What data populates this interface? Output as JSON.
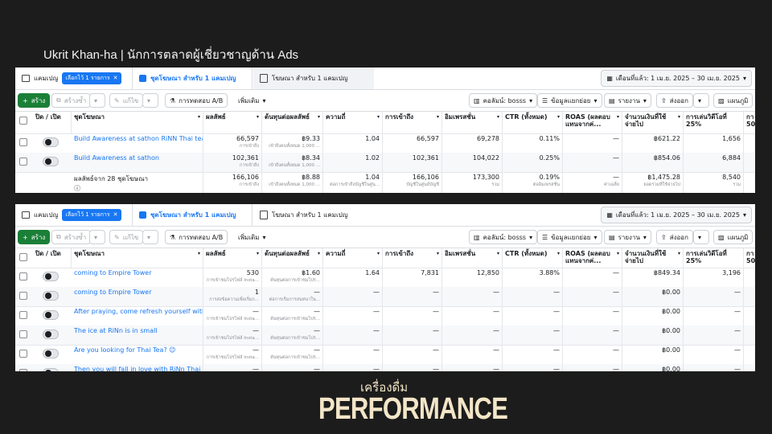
{
  "header": {
    "title": "Ukrit Khan-ha | นักการตลาดผู้เชี่ยวชาญด้าน Ads"
  },
  "footer": {
    "subtitle": "เครื่องดื่ม",
    "title": "PERFORMANCE"
  },
  "tabs": {
    "campaign": "แคมเปญ",
    "selected_chip": "เลือกไว้ 1 รายการ",
    "adset": "ชุดโฆษณา สำหรับ 1 แคมเปญ",
    "ads": "โฆษณา สำหรับ 1 แคมเปญ"
  },
  "date_range": "เดือนที่แล้ว: 1 เม.ย. 2025 – 30 เม.ย. 2025",
  "toolbar": {
    "create": "สร้าง",
    "duplicate": "สร้างซ้ำ",
    "edit": "แก้ไข",
    "ab_test": "การทดสอบ A/B",
    "more": "เพิ่มเติม",
    "columns": "คอลัมน์: bosss",
    "breakdown": "ข้อมูลแยกย่อย",
    "reports": "รายงาน",
    "export": "ส่งออก",
    "charts": "แผนภูมิ"
  },
  "table1": {
    "headers": [
      "ปิด / เปิด",
      "ชุดโฆษณา",
      "ผลลัพธ์",
      "ต้นทุนต่อผลลัพธ์",
      "ความถี่",
      "การเข้าถึง",
      "อิมเพรสชั่น",
      "CTR (ทั้งหมด)",
      "ROAS (ผลตอบแทนจากค่...",
      "จำนวนเงินที่ใช้จ่ายไป",
      "การเล่นวิดีโอที่ 25%",
      "กา 50"
    ],
    "rows": [
      {
        "name": "Build Awareness at sathon RiNN Thai tea detail...",
        "results": "66,597",
        "results_sub": "การเข้าถึง",
        "cpr": "฿9.33",
        "cpr_sub": "เข้าถึงคนทั้งหมด 1,000 ...",
        "freq": "1.04",
        "reach": "66,597",
        "impr": "69,278",
        "ctr": "0.11%",
        "roas": "—",
        "spent": "฿621.22",
        "v25": "1,656",
        "v50": ""
      },
      {
        "name": "Build Awareness at sathon",
        "results": "102,361",
        "results_sub": "การเข้าถึง",
        "cpr": "฿8.34",
        "cpr_sub": "เข้าถึงคนทั้งหมด 1,000 ...",
        "freq": "1.02",
        "reach": "102,361",
        "impr": "104,022",
        "ctr": "0.25%",
        "roas": "—",
        "spent": "฿854.06",
        "v25": "6,884",
        "v50": ""
      }
    ],
    "total": {
      "name": "ผลลัพธ์จาก 28 ชุดโฆษณา",
      "results": "166,106",
      "results_sub": "การเข้าถึง",
      "cpr": "฿8.88",
      "cpr_sub": "เข้าถึงคนทั้งหมด 1,000 ...",
      "freq": "1.04",
      "freq_sub": "ต่อการเข้าถึงบัญชีในศูน...",
      "reach": "166,106",
      "reach_sub": "บัญชีในศูนย์บัญชี",
      "impr": "173,300",
      "impr_sub": "รวม",
      "ctr": "0.19%",
      "ctr_sub": "ต่ออิมเพรสชั่น",
      "roas": "—",
      "roas_sub": "ค่าเฉลี่ย",
      "spent": "฿1,475.28",
      "spent_sub": "ยอดรวมที่ใช้จ่ายไป",
      "v25": "8,540",
      "v25_sub": "รวม"
    }
  },
  "table2": {
    "headers": [
      "ปิด / เปิด",
      "ชุดโฆษณา",
      "ผลลัพธ์",
      "ต้นทุนต่อผลลัพธ์",
      "ความถี่",
      "การเข้าถึง",
      "อิมเพรสชั่น",
      "CTR (ทั้งหมด)",
      "ROAS (ผลตอบแทนจากค่...",
      "จำนวนเงินที่ใช้จ่ายไป",
      "การเล่นวิดีโอที่ 25%",
      "กา 50"
    ],
    "rows": [
      {
        "name": "coming to Empire Tower",
        "results": "530",
        "results_sub": "การเข้าชมโปรไฟล์ Insta...",
        "cpr": "฿1.60",
        "cpr_sub": "ต้นทุนต่อการเข้าชมโปร...",
        "freq": "1.64",
        "reach": "7,831",
        "impr": "12,850",
        "ctr": "3.88%",
        "roas": "—",
        "spent": "฿849.34",
        "v25": "3,196"
      },
      {
        "name": "coming to Empire Tower",
        "results": "1",
        "results_sub": "การส่งข้อความเพื่อเริ่มก...",
        "cpr": "—",
        "cpr_sub": "ต่อการเริ่มการสนทนาใน...",
        "freq": "—",
        "reach": "—",
        "impr": "—",
        "ctr": "—",
        "roas": "—",
        "spent": "฿0.00",
        "v25": "—"
      },
      {
        "name": "After praying, come refresh yourself with a cup...",
        "results": "—",
        "results_sub": "การเข้าชมโปรไฟล์ Insta...",
        "cpr": "—",
        "cpr_sub": "ต้นทุนต่อการเข้าชมโปร...",
        "freq": "—",
        "reach": "—",
        "impr": "—",
        "ctr": "—",
        "roas": "—",
        "spent": "฿0.00",
        "v25": "—"
      },
      {
        "name": "The ice at RiNn is in small",
        "results": "—",
        "results_sub": "การเข้าชมโปรไฟล์ Insta...",
        "cpr": "—",
        "cpr_sub": "ต้นทุนต่อการเข้าชมโปร...",
        "freq": "—",
        "reach": "—",
        "impr": "—",
        "ctr": "—",
        "roas": "—",
        "spent": "฿0.00",
        "v25": "—"
      },
      {
        "name": "Are you looking for Thai Tea? 😉",
        "results": "—",
        "results_sub": "การเข้าชมโปรไฟล์ Insta...",
        "cpr": "—",
        "cpr_sub": "ต้นทุนต่อการเข้าชมโปร...",
        "freq": "—",
        "reach": "—",
        "impr": "—",
        "ctr": "—",
        "roas": "—",
        "spent": "฿0.00",
        "v25": "—"
      },
      {
        "name": "Then you will fall in love with RiNn Thai Tea 🧋",
        "results": "—",
        "results_sub": "การเข้าชมโปรไฟล์ Insta...",
        "cpr": "—",
        "cpr_sub": "ต้นทุนต่อการเข้าชมโปร...",
        "freq": "—",
        "reach": "—",
        "impr": "—",
        "ctr": "—",
        "roas": "—",
        "spent": "฿0.00",
        "v25": "—"
      }
    ]
  }
}
